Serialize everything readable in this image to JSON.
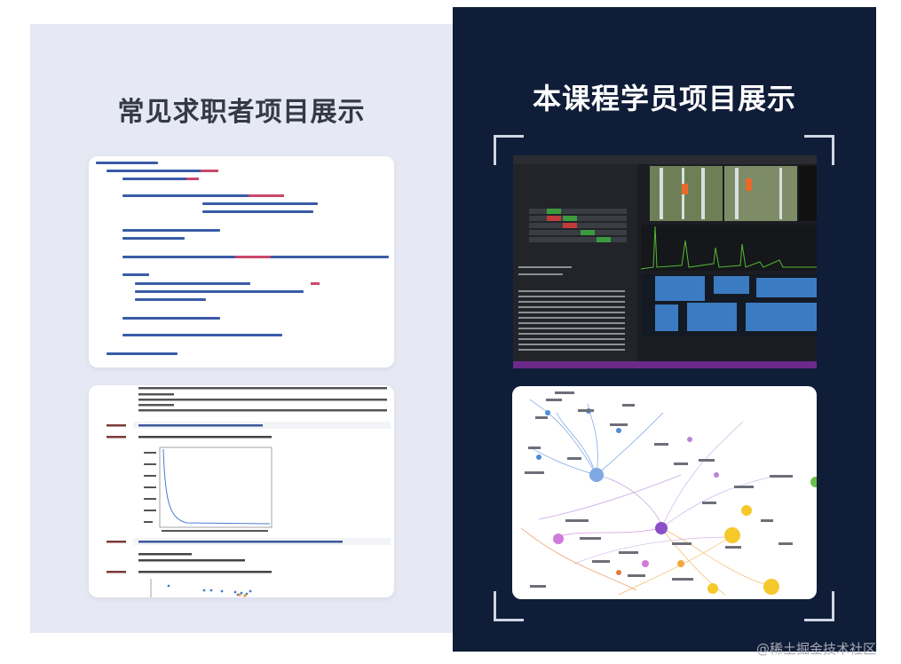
{
  "left": {
    "title": "常见求职者项目展示"
  },
  "right": {
    "title": "本课程学员项目展示"
  },
  "watermark": "@稀土掘金技术社区",
  "colors": {
    "left_panel_bg": "#e6e8f3",
    "right_panel_bg": "#0f1d38",
    "left_title": "#333a45",
    "right_title": "#ffffff"
  },
  "icons": [
    "corner-bracket-icon"
  ]
}
